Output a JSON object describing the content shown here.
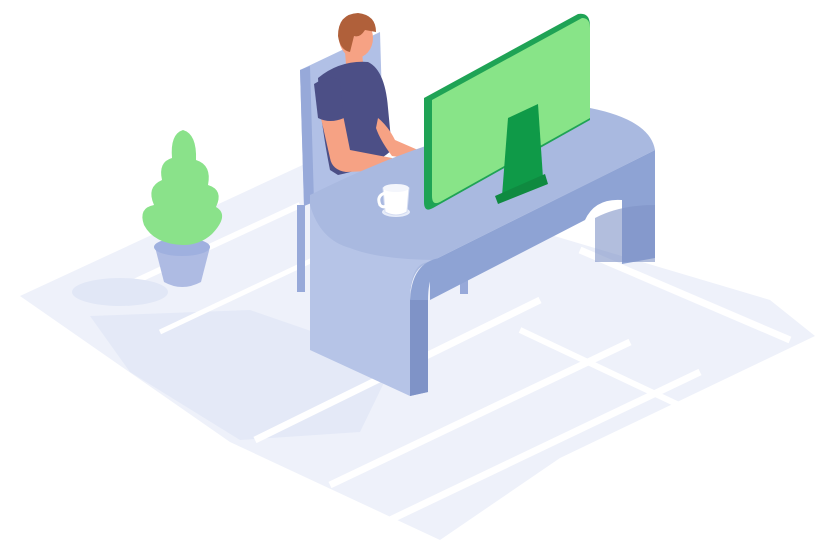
{
  "illustration": {
    "subject": "person-working-at-desk",
    "icons": [
      "floor-tiles",
      "plant-icon",
      "chair-icon",
      "person-icon",
      "desk-icon",
      "monitor-icon",
      "coffee-cup-icon"
    ],
    "colors": {
      "background": "#ffffff",
      "floor_main": "#eef1fa",
      "floor_shadow": "#e1e7f6",
      "floor_lines": "#ffffff",
      "desk_top": "#a9b9e0",
      "desk_front": "#b6c4e7",
      "desk_side": "#8ea3d4",
      "desk_dark": "#7f93c7",
      "chair": "#b1c0e6",
      "chair_dark": "#97a9d9",
      "monitor_screen": "#88e488",
      "monitor_frame": "#1fa355",
      "monitor_stand": "#0f9a48",
      "plant_leaf": "#8ae28a",
      "pot": "#aebbe3",
      "shirt": "#4c4f86",
      "skin": "#f6a284",
      "hair": "#b0603a",
      "cup": "#ffffff"
    }
  }
}
